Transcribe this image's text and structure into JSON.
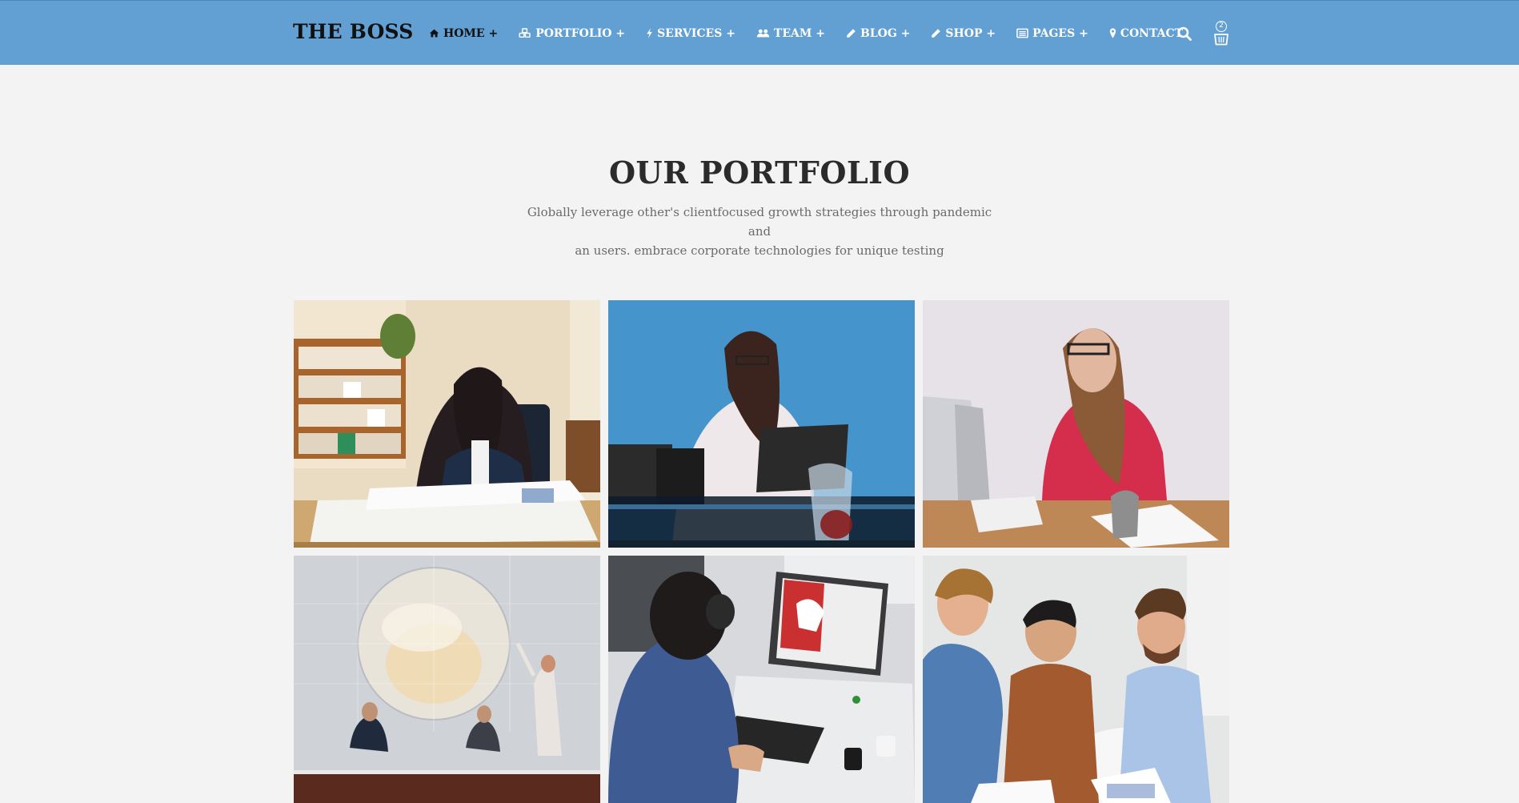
{
  "header": {
    "logo": "THE BOSS",
    "nav": [
      {
        "label": "HOME +",
        "icon": "home-icon",
        "active": true
      },
      {
        "label": "PORTFOLIO +",
        "icon": "cubes-icon",
        "active": false
      },
      {
        "label": "SERVICES +",
        "icon": "bolt-icon",
        "active": false
      },
      {
        "label": "TEAM +",
        "icon": "users-icon",
        "active": false
      },
      {
        "label": "BLOG +",
        "icon": "pencil-icon",
        "active": false
      },
      {
        "label": "SHOP +",
        "icon": "pencil-icon",
        "active": false
      },
      {
        "label": "PAGES +",
        "icon": "list-icon",
        "active": false
      },
      {
        "label": "CONTACT",
        "icon": "map-marker-icon",
        "active": false
      }
    ],
    "search_icon": "search-icon",
    "cart_icon": "shopping-basket-icon",
    "cart_count": "2",
    "bar_color": "#629fd3"
  },
  "portfolio": {
    "title": "OUR PORTFOLIO",
    "subtitle_line1": "Globally leverage other's clientfocused growth strategies through pandemic and",
    "subtitle_line2": "an users. embrace corporate technologies for unique testing",
    "items": [
      {
        "scene": "businesswoman-reading-newspaper-at-desk"
      },
      {
        "scene": "woman-with-laptop-blue-wall"
      },
      {
        "scene": "smiling-woman-red-jacket-laptop"
      },
      {
        "scene": "presentation-globe-conference-room"
      },
      {
        "scene": "designer-at-computer-eagle-image"
      },
      {
        "scene": "three-smiling-men-at-table"
      }
    ]
  }
}
